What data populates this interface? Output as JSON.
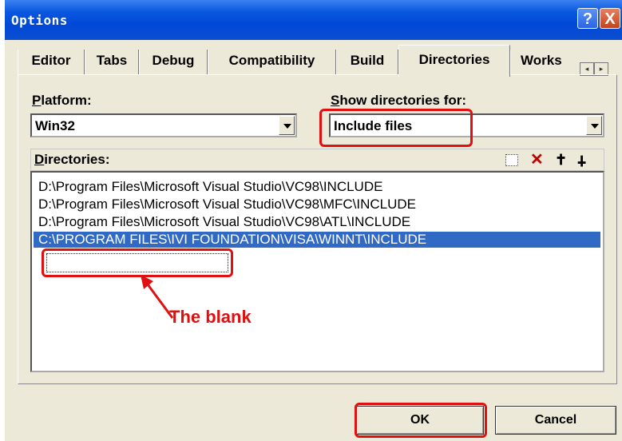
{
  "window": {
    "title": "Options",
    "help_glyph": "?",
    "close_glyph": "X"
  },
  "tabs": [
    {
      "label": "Editor"
    },
    {
      "label": "Tabs"
    },
    {
      "label": "Debug"
    },
    {
      "label": "Compatibility"
    },
    {
      "label": "Build"
    },
    {
      "label": "Directories",
      "active": true
    },
    {
      "label": "Works"
    }
  ],
  "tab_scroll": {
    "left": "◂",
    "right": "▸"
  },
  "platform": {
    "label": "Platform:",
    "value": "Win32"
  },
  "show_for": {
    "label": "Show directories for:",
    "value": "Include files"
  },
  "directories": {
    "label": "Directories:",
    "toolbar_icons": [
      "new-folder-icon",
      "delete-icon",
      "move-up-icon",
      "move-down-icon"
    ],
    "delete_glyph": "✕",
    "up_glyph": "✝",
    "down_glyph": "✝",
    "items": [
      "D:\\Program Files\\Microsoft Visual Studio\\VC98\\INCLUDE",
      "D:\\Program Files\\Microsoft Visual Studio\\VC98\\MFC\\INCLUDE",
      "D:\\Program Files\\Microsoft Visual Studio\\VC98\\ATL\\INCLUDE",
      "C:\\PROGRAM FILES\\IVI FOUNDATION\\VISA\\WINNT\\INCLUDE"
    ],
    "selected_index": 3
  },
  "annotation": {
    "text": "The blank",
    "color": "#e01010"
  },
  "buttons": {
    "ok": "OK",
    "cancel": "Cancel"
  },
  "colors": {
    "titlebar": "#0a57e0",
    "selection": "#316ac5",
    "dialog_bg": "#ece9d8",
    "highlight": "#e01010"
  }
}
